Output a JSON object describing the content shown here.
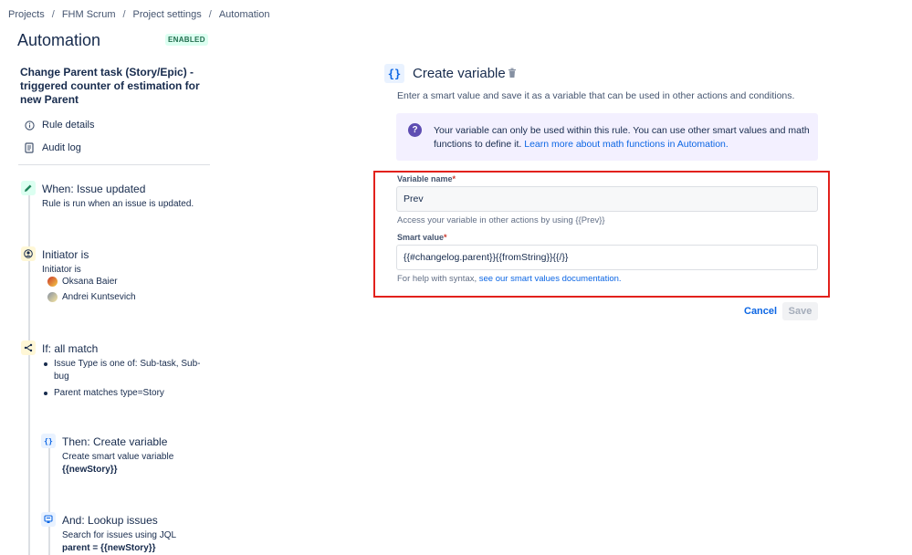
{
  "breadcrumb": {
    "items": [
      "Projects",
      "FHM Scrum",
      "Project settings",
      "Automation"
    ],
    "separator": "/"
  },
  "header": {
    "title": "Automation",
    "status": "ENABLED"
  },
  "rule": {
    "name": "Change Parent task (Story/Epic) - triggered counter of estimation for new Parent"
  },
  "sidebar": {
    "links": [
      {
        "label": "Rule details",
        "icon": "info-icon"
      },
      {
        "label": "Audit log",
        "icon": "document-icon"
      }
    ]
  },
  "steps": {
    "trigger": {
      "title": "When: Issue updated",
      "desc": "Rule is run when an issue is updated.",
      "icon": "pencil-icon"
    },
    "initiator": {
      "title": "Initiator is",
      "desc": "Initiator is",
      "users": [
        "Oksana Baier",
        "Andrei Kuntsevich"
      ],
      "icon": "user-icon"
    },
    "condition": {
      "title": "If: all match",
      "items": [
        "Issue Type is one of: Sub-task, Sub-bug",
        "Parent matches type=Story"
      ],
      "icon": "branch-icon"
    },
    "create_var": {
      "title": "Then: Create variable",
      "desc": "Create smart value variable",
      "code": "{{newStory}}",
      "icon_glyph": "{}"
    },
    "lookup": {
      "title": "And: Lookup issues",
      "desc": "Search for issues using JQL",
      "code": "parent = {{newStory}}",
      "icon": "search-issues-icon"
    }
  },
  "panel": {
    "icon_glyph": "{}",
    "title": "Create variable",
    "description": "Enter a smart value and save it as a variable that can be used in other actions and conditions.",
    "info": {
      "text": "Your variable can only be used within this rule. You can use other smart values and math functions to define it. ",
      "link": "Learn more about math functions in Automation.",
      "icon_glyph": "?"
    },
    "variable_name": {
      "label": "Variable name",
      "required_mark": "*",
      "value": "Prev",
      "help": "Access your variable in other actions by using {{Prev}}"
    },
    "smart_value": {
      "label": "Smart value",
      "required_mark": "*",
      "value": "{{#changelog.parent}}{{fromString}}{{/}}",
      "help_prefix": "For help with syntax, ",
      "help_link": "see our smart values documentation."
    },
    "actions": {
      "cancel": "Cancel",
      "save": "Save"
    }
  },
  "colors": {
    "accent": "#0c66e4",
    "highlight": "#e2211c",
    "info_bg": "#f3f0ff"
  }
}
